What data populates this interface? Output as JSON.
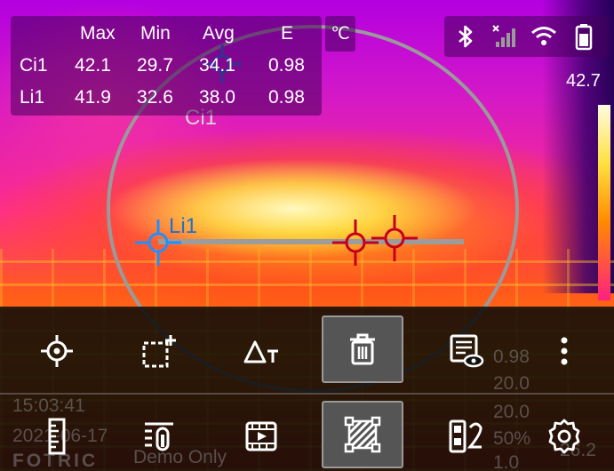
{
  "measurement_table": {
    "headers": [
      "Max",
      "Min",
      "Avg",
      "E"
    ],
    "rows": [
      {
        "name": "Ci1",
        "max": "42.1",
        "min": "29.7",
        "avg": "34.1",
        "e": "0.98"
      },
      {
        "name": "Li1",
        "max": "41.9",
        "min": "32.6",
        "avg": "38.0",
        "e": "0.98"
      }
    ]
  },
  "unit": "℃",
  "status_icons": [
    "bluetooth-icon",
    "cellular-signal-icon",
    "wifi-icon",
    "battery-icon"
  ],
  "color_scale": {
    "max": "42.7",
    "min": "26.2"
  },
  "overlay_labels": {
    "circle": "Ci1",
    "line": "Li1"
  },
  "toolbar": {
    "row1": [
      "point-measure-icon",
      "add-area-icon",
      "temperature-difference-icon",
      "delete-icon",
      "display-settings-icon",
      "more-icon"
    ],
    "row2": [
      "ruler-icon",
      "thermometer-settings-icon",
      "video-icon",
      "fusion-icon",
      "compare-icon",
      "settings-icon"
    ],
    "selected": [
      "delete-icon",
      "fusion-icon"
    ]
  },
  "background_info": {
    "time": "15:03:41",
    "date": "2021-06-17",
    "brand": "FOTRIC",
    "watermark": "Demo Only",
    "values": [
      "0.98",
      "20.0",
      "20.0",
      "50%",
      "1.0"
    ]
  },
  "colors": {
    "cursor_blue": "#1e90ff",
    "cursor_red": "#c4001c",
    "selected_bg": "#555555"
  }
}
